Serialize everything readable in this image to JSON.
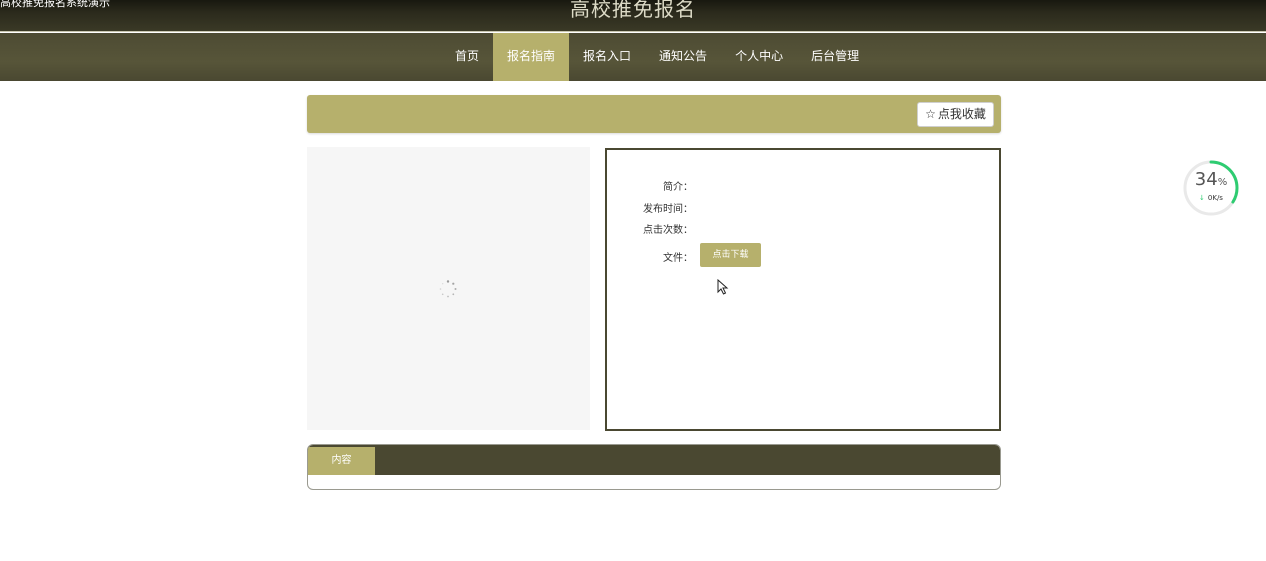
{
  "header": {
    "tagline": "高校推免报名系统演示",
    "site_title": "高校推免报名"
  },
  "nav": {
    "items": [
      "首页",
      "报名指南",
      "报名入口",
      "通知公告",
      "个人中心",
      "后台管理"
    ],
    "active_index": 1
  },
  "detail": {
    "favorite_label": "点我收藏",
    "favorite_icon": "star-outline-icon",
    "fields": {
      "intro_label": "简介：",
      "publish_time_label": "发布时间：",
      "click_count_label": "点击次数：",
      "file_label": "文件："
    },
    "download_label": "点击下载"
  },
  "content": {
    "tab_label": "内容"
  },
  "speed_widget": {
    "percent": "34",
    "percent_unit": "%",
    "rate": "0K/s",
    "progress_fraction": 0.34
  },
  "colors": {
    "accent": "#b6b06c",
    "dark": "#4a4831",
    "progress": "#2ecc71"
  }
}
